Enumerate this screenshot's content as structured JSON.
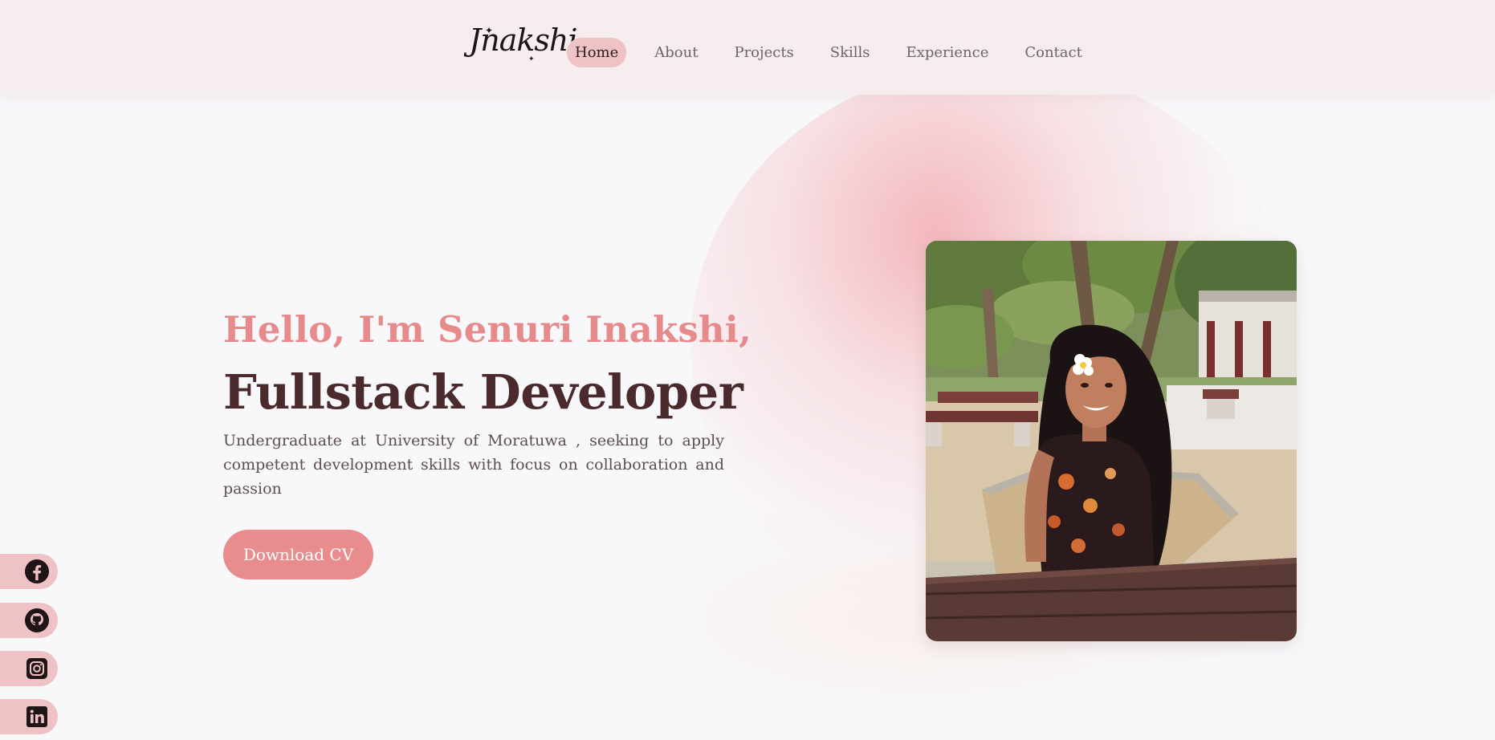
{
  "header": {
    "logo_text": "Jnakshi",
    "nav": [
      {
        "label": "Home",
        "active": true
      },
      {
        "label": "About",
        "active": false
      },
      {
        "label": "Projects",
        "active": false
      },
      {
        "label": "Skills",
        "active": false
      },
      {
        "label": "Experience",
        "active": false
      },
      {
        "label": "Contact",
        "active": false
      }
    ]
  },
  "hero": {
    "greeting": "Hello, I'm Senuri Inakshi,",
    "role": "Fullstack Developer",
    "description": "Undergraduate at University of Moratuwa , seeking to apply competent development skills with focus on collaboration and passion",
    "cv_button": "Download CV"
  },
  "social": [
    {
      "icon": "facebook-icon"
    },
    {
      "icon": "github-icon"
    },
    {
      "icon": "instagram-icon"
    },
    {
      "icon": "linkedin-icon"
    }
  ],
  "colors": {
    "accent": "#e88c8d",
    "heading": "#4a2a2c",
    "nav_active_bg": "#efc3c5",
    "header_bg": "#f6edee",
    "page_bg": "#f8f8fb"
  }
}
